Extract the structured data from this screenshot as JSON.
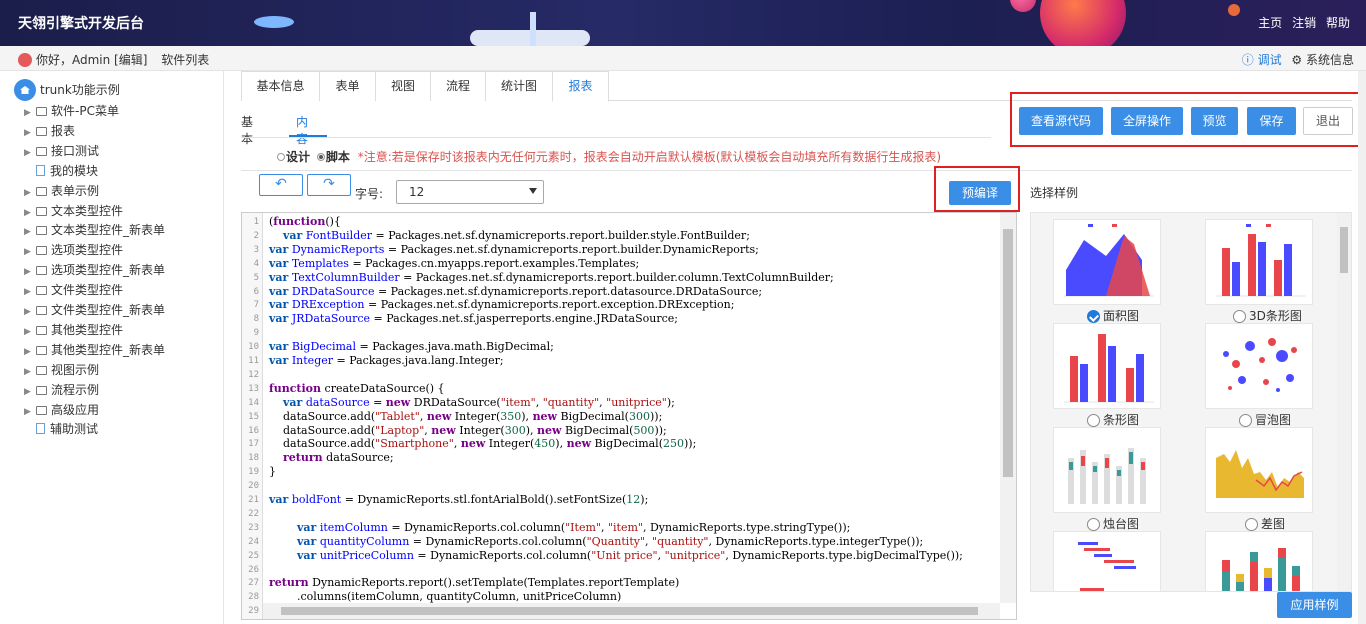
{
  "app": {
    "title": "天翎引擎式开发后台"
  },
  "top_nav": {
    "home": "主页",
    "logout": "注销",
    "help": "帮助"
  },
  "user_bar": {
    "greeting": "你好，Admin [编辑]",
    "software_list": "软件列表",
    "debug": "ⓘ 调试",
    "system_info": "⚙ 系统信息"
  },
  "sidebar": {
    "root": "trunk功能示例",
    "items": [
      {
        "label": "软件-PC菜单",
        "type": "folder"
      },
      {
        "label": "报表",
        "type": "folder"
      },
      {
        "label": "接口测试",
        "type": "folder"
      },
      {
        "label": "我的模块",
        "type": "file"
      },
      {
        "label": "表单示例",
        "type": "folder"
      },
      {
        "label": "文本类型控件",
        "type": "folder"
      },
      {
        "label": "文本类型控件_新表单",
        "type": "folder"
      },
      {
        "label": "选项类型控件",
        "type": "folder"
      },
      {
        "label": "选项类型控件_新表单",
        "type": "folder"
      },
      {
        "label": "文件类型控件",
        "type": "folder"
      },
      {
        "label": "文件类型控件_新表单",
        "type": "folder"
      },
      {
        "label": "其他类型控件",
        "type": "folder"
      },
      {
        "label": "其他类型控件_新表单",
        "type": "folder"
      },
      {
        "label": "视图示例",
        "type": "folder"
      },
      {
        "label": "流程示例",
        "type": "folder"
      },
      {
        "label": "高级应用",
        "type": "folder"
      },
      {
        "label": "辅助测试",
        "type": "file"
      }
    ]
  },
  "tabs": [
    "基本信息",
    "表单",
    "视图",
    "流程",
    "统计图",
    "报表"
  ],
  "active_tab": "报表",
  "subtabs": {
    "basic": "基本",
    "content": "内容"
  },
  "actions": {
    "view_source": "查看源代码",
    "fullscreen": "全屏操作",
    "preview": "预览",
    "save": "保存",
    "exit": "退出"
  },
  "mode": {
    "design": "设计",
    "script": "脚本",
    "notice": "*注意:若是保存时该报表内无任何元素时，报表会自动开启默认模板(默认模板会自动填充所有数据行生成报表)"
  },
  "toolbar": {
    "undo": "↶",
    "redo": "↷",
    "font_label": "字号:",
    "font_size": "12",
    "precompile": "预编译",
    "select_sample": "选择样例"
  },
  "code_lines": [
    "(function(){",
    "    var FontBuilder = Packages.net.sf.dynamicreports.report.builder.style.FontBuilder;",
    "var DynamicReports = Packages.net.sf.dynamicreports.report.builder.DynamicReports;",
    "var Templates = Packages.cn.myapps.report.examples.Templates;",
    "var TextColumnBuilder = Packages.net.sf.dynamicreports.report.builder.column.TextColumnBuilder;",
    "var DRDataSource = Packages.net.sf.dynamicreports.report.datasource.DRDataSource;",
    "var DRException = Packages.net.sf.dynamicreports.report.exception.DRException;",
    "var JRDataSource = Packages.net.sf.jasperreports.engine.JRDataSource;",
    "",
    "var BigDecimal = Packages.java.math.BigDecimal;",
    "var Integer = Packages.java.lang.Integer;",
    "",
    "function createDataSource() {",
    "    var dataSource = new DRDataSource(\"item\", \"quantity\", \"unitprice\");",
    "    dataSource.add(\"Tablet\", new Integer(350), new BigDecimal(300));",
    "    dataSource.add(\"Laptop\", new Integer(300), new BigDecimal(500));",
    "    dataSource.add(\"Smartphone\", new Integer(450), new BigDecimal(250));",
    "    return dataSource;",
    "}",
    "",
    "var boldFont = DynamicReports.stl.fontArialBold().setFontSize(12);",
    "",
    "        var itemColumn = DynamicReports.col.column(\"Item\", \"item\", DynamicReports.type.stringType());",
    "        var quantityColumn = DynamicReports.col.column(\"Quantity\", \"quantity\", DynamicReports.type.integerType());",
    "        var unitPriceColumn = DynamicReports.col.column(\"Unit price\", \"unitprice\", DynamicReports.type.bigDecimalType());",
    "",
    "return DynamicReports.report().setTemplate(Templates.reportTemplate)",
    "        .columns(itemColumn, quantityColumn, unitPriceColumn)",
    ""
  ],
  "samples": [
    {
      "label": "面积图",
      "selected": true,
      "icon": "area-chart-thumb"
    },
    {
      "label": "3D条形图",
      "selected": false,
      "icon": "3d-bar-chart-thumb"
    },
    {
      "label": "条形图",
      "selected": false,
      "icon": "bar-chart-thumb"
    },
    {
      "label": "冒泡图",
      "selected": false,
      "icon": "bubble-chart-thumb"
    },
    {
      "label": "烛台图",
      "selected": false,
      "icon": "candlestick-chart-thumb"
    },
    {
      "label": "差图",
      "selected": false,
      "icon": "difference-chart-thumb"
    },
    {
      "label": "",
      "selected": false,
      "icon": "gantt-chart-thumb"
    },
    {
      "label": "",
      "selected": false,
      "icon": "stacked-bar-chart-thumb"
    }
  ],
  "apply_sample": "应用样例",
  "colors": {
    "primary": "#3a8ee6",
    "highlight_border": "#e02020",
    "topbar": "#1f2258"
  }
}
